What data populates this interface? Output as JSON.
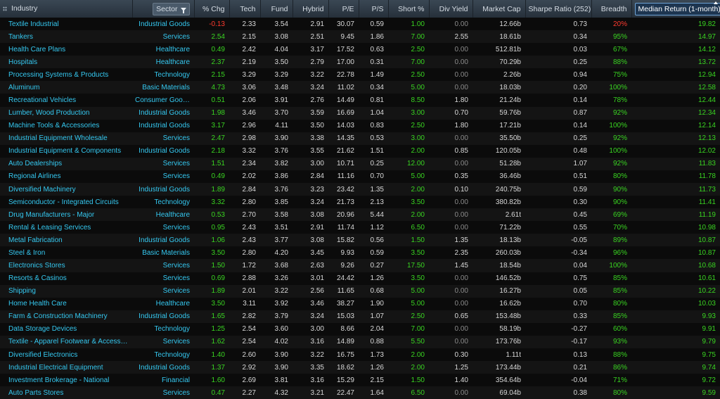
{
  "columns": [
    {
      "key": "industry",
      "label": "Industry"
    },
    {
      "key": "sector",
      "label": "Sector"
    },
    {
      "key": "chg",
      "label": "% Chg"
    },
    {
      "key": "tech",
      "label": "Tech"
    },
    {
      "key": "fund",
      "label": "Fund"
    },
    {
      "key": "hybrid",
      "label": "Hybrid"
    },
    {
      "key": "pe",
      "label": "P/E"
    },
    {
      "key": "ps",
      "label": "P/S"
    },
    {
      "key": "short",
      "label": "Short %"
    },
    {
      "key": "div",
      "label": "Div Yield"
    },
    {
      "key": "mcap",
      "label": "Market Cap"
    },
    {
      "key": "sharpe",
      "label": "Sharpe Ratio (252)"
    },
    {
      "key": "breadth",
      "label": "Breadth"
    },
    {
      "key": "median",
      "label": "Median Return (1-month)"
    }
  ],
  "colors": {
    "link": "#35c8f0",
    "positive": "#39d421",
    "negative": "#ff3b2f",
    "header_bg": "#2f3b47"
  },
  "rows": [
    {
      "industry": "Textile Industrial",
      "sector": "Industrial Goods",
      "chg": "-0.13",
      "tech": "2.33",
      "fund": "3.54",
      "hybrid": "2.91",
      "pe": "30.07",
      "ps": "0.59",
      "short": "1.00",
      "div": "0.00",
      "mcap": "12.66b",
      "sharpe": "0.73",
      "breadth": "20%",
      "median": "19.82"
    },
    {
      "industry": "Tankers",
      "sector": "Services",
      "chg": "2.54",
      "tech": "2.15",
      "fund": "3.08",
      "hybrid": "2.51",
      "pe": "9.45",
      "ps": "1.86",
      "short": "7.00",
      "div": "2.55",
      "mcap": "18.61b",
      "sharpe": "0.34",
      "breadth": "95%",
      "median": "14.97"
    },
    {
      "industry": "Health Care Plans",
      "sector": "Healthcare",
      "chg": "0.49",
      "tech": "2.42",
      "fund": "4.04",
      "hybrid": "3.17",
      "pe": "17.52",
      "ps": "0.63",
      "short": "2.50",
      "div": "0.00",
      "mcap": "512.81b",
      "sharpe": "0.03",
      "breadth": "67%",
      "median": "14.12"
    },
    {
      "industry": "Hospitals",
      "sector": "Healthcare",
      "chg": "2.37",
      "tech": "2.19",
      "fund": "3.50",
      "hybrid": "2.79",
      "pe": "17.00",
      "ps": "0.31",
      "short": "7.00",
      "div": "0.00",
      "mcap": "70.29b",
      "sharpe": "0.25",
      "breadth": "88%",
      "median": "13.72"
    },
    {
      "industry": "Processing Systems & Products",
      "sector": "Technology",
      "chg": "2.15",
      "tech": "3.29",
      "fund": "3.29",
      "hybrid": "3.22",
      "pe": "22.78",
      "ps": "1.49",
      "short": "2.50",
      "div": "0.00",
      "mcap": "2.26b",
      "sharpe": "0.94",
      "breadth": "75%",
      "median": "12.94"
    },
    {
      "industry": "Aluminum",
      "sector": "Basic Materials",
      "chg": "4.73",
      "tech": "3.06",
      "fund": "3.48",
      "hybrid": "3.24",
      "pe": "11.02",
      "ps": "0.34",
      "short": "5.00",
      "div": "0.00",
      "mcap": "18.03b",
      "sharpe": "0.20",
      "breadth": "100%",
      "median": "12.58"
    },
    {
      "industry": "Recreational Vehicles",
      "sector": "Consumer Goods",
      "chg": "0.51",
      "tech": "2.06",
      "fund": "3.91",
      "hybrid": "2.76",
      "pe": "14.49",
      "ps": "0.81",
      "short": "8.50",
      "div": "1.80",
      "mcap": "21.24b",
      "sharpe": "0.14",
      "breadth": "78%",
      "median": "12.44"
    },
    {
      "industry": "Lumber, Wood Production",
      "sector": "Industrial Goods",
      "chg": "1.98",
      "tech": "3.46",
      "fund": "3.70",
      "hybrid": "3.59",
      "pe": "16.69",
      "ps": "1.04",
      "short": "3.00",
      "div": "0.70",
      "mcap": "59.76b",
      "sharpe": "0.87",
      "breadth": "92%",
      "median": "12.34"
    },
    {
      "industry": "Machine Tools & Accessories",
      "sector": "Industrial Goods",
      "chg": "3.17",
      "tech": "2.96",
      "fund": "4.11",
      "hybrid": "3.50",
      "pe": "14.03",
      "ps": "0.83",
      "short": "2.50",
      "div": "1.80",
      "mcap": "17.21b",
      "sharpe": "0.14",
      "breadth": "100%",
      "median": "12.14"
    },
    {
      "industry": "Industrial Equipment Wholesale",
      "sector": "Services",
      "chg": "2.47",
      "tech": "2.98",
      "fund": "3.90",
      "hybrid": "3.38",
      "pe": "14.35",
      "ps": "0.53",
      "short": "3.00",
      "div": "0.00",
      "mcap": "35.50b",
      "sharpe": "0.25",
      "breadth": "92%",
      "median": "12.13"
    },
    {
      "industry": "Industrial Equipment & Components",
      "sector": "Industrial Goods",
      "chg": "2.18",
      "tech": "3.32",
      "fund": "3.76",
      "hybrid": "3.55",
      "pe": "21.62",
      "ps": "1.51",
      "short": "2.00",
      "div": "0.85",
      "mcap": "120.05b",
      "sharpe": "0.48",
      "breadth": "100%",
      "median": "12.02"
    },
    {
      "industry": "Auto Dealerships",
      "sector": "Services",
      "chg": "1.51",
      "tech": "2.34",
      "fund": "3.82",
      "hybrid": "3.00",
      "pe": "10.71",
      "ps": "0.25",
      "short": "12.00",
      "div": "0.00",
      "mcap": "51.28b",
      "sharpe": "1.07",
      "breadth": "92%",
      "median": "11.83"
    },
    {
      "industry": "Regional Airlines",
      "sector": "Services",
      "chg": "0.49",
      "tech": "2.02",
      "fund": "3.86",
      "hybrid": "2.84",
      "pe": "11.16",
      "ps": "0.70",
      "short": "5.00",
      "div": "0.35",
      "mcap": "36.46b",
      "sharpe": "0.51",
      "breadth": "80%",
      "median": "11.78"
    },
    {
      "industry": "Diversified Machinery",
      "sector": "Industrial Goods",
      "chg": "1.89",
      "tech": "2.84",
      "fund": "3.76",
      "hybrid": "3.23",
      "pe": "23.42",
      "ps": "1.35",
      "short": "2.00",
      "div": "0.10",
      "mcap": "240.75b",
      "sharpe": "0.59",
      "breadth": "90%",
      "median": "11.73"
    },
    {
      "industry": "Semiconductor - Integrated Circuits",
      "sector": "Technology",
      "chg": "3.32",
      "tech": "2.80",
      "fund": "3.85",
      "hybrid": "3.24",
      "pe": "21.73",
      "ps": "2.13",
      "short": "3.50",
      "div": "0.00",
      "mcap": "380.82b",
      "sharpe": "0.30",
      "breadth": "90%",
      "median": "11.41"
    },
    {
      "industry": "Drug Manufacturers - Major",
      "sector": "Healthcare",
      "chg": "0.53",
      "tech": "2.70",
      "fund": "3.58",
      "hybrid": "3.08",
      "pe": "20.96",
      "ps": "5.44",
      "short": "2.00",
      "div": "0.00",
      "mcap": "2.61t",
      "sharpe": "0.45",
      "breadth": "69%",
      "median": "11.19"
    },
    {
      "industry": "Rental & Leasing Services",
      "sector": "Services",
      "chg": "0.95",
      "tech": "2.43",
      "fund": "3.51",
      "hybrid": "2.91",
      "pe": "11.74",
      "ps": "1.12",
      "short": "6.50",
      "div": "0.00",
      "mcap": "71.22b",
      "sharpe": "0.55",
      "breadth": "70%",
      "median": "10.98"
    },
    {
      "industry": "Metal Fabrication",
      "sector": "Industrial Goods",
      "chg": "1.06",
      "tech": "2.43",
      "fund": "3.77",
      "hybrid": "3.08",
      "pe": "15.82",
      "ps": "0.56",
      "short": "1.50",
      "div": "1.35",
      "mcap": "18.13b",
      "sharpe": "-0.05",
      "breadth": "89%",
      "median": "10.87"
    },
    {
      "industry": "Steel & Iron",
      "sector": "Basic Materials",
      "chg": "3.50",
      "tech": "2.80",
      "fund": "4.20",
      "hybrid": "3.45",
      "pe": "9.93",
      "ps": "0.59",
      "short": "3.50",
      "div": "2.35",
      "mcap": "260.03b",
      "sharpe": "-0.34",
      "breadth": "96%",
      "median": "10.87"
    },
    {
      "industry": "Electronics Stores",
      "sector": "Services",
      "chg": "1.50",
      "tech": "1.72",
      "fund": "3.68",
      "hybrid": "2.63",
      "pe": "9.26",
      "ps": "0.27",
      "short": "17.50",
      "div": "1.45",
      "mcap": "18.54b",
      "sharpe": "0.04",
      "breadth": "100%",
      "median": "10.68"
    },
    {
      "industry": "Resorts & Casinos",
      "sector": "Services",
      "chg": "0.69",
      "tech": "2.88",
      "fund": "3.26",
      "hybrid": "3.01",
      "pe": "24.42",
      "ps": "1.26",
      "short": "3.50",
      "div": "0.00",
      "mcap": "146.52b",
      "sharpe": "0.75",
      "breadth": "85%",
      "median": "10.61"
    },
    {
      "industry": "Shipping",
      "sector": "Services",
      "chg": "1.89",
      "tech": "2.01",
      "fund": "3.22",
      "hybrid": "2.56",
      "pe": "11.65",
      "ps": "0.68",
      "short": "5.00",
      "div": "0.00",
      "mcap": "16.27b",
      "sharpe": "0.05",
      "breadth": "85%",
      "median": "10.22"
    },
    {
      "industry": "Home Health Care",
      "sector": "Healthcare",
      "chg": "3.50",
      "tech": "3.11",
      "fund": "3.92",
      "hybrid": "3.46",
      "pe": "38.27",
      "ps": "1.90",
      "short": "5.00",
      "div": "0.00",
      "mcap": "16.62b",
      "sharpe": "0.70",
      "breadth": "80%",
      "median": "10.03"
    },
    {
      "industry": "Farm & Construction Machinery",
      "sector": "Industrial Goods",
      "chg": "1.65",
      "tech": "2.82",
      "fund": "3.79",
      "hybrid": "3.24",
      "pe": "15.03",
      "ps": "1.07",
      "short": "2.50",
      "div": "0.65",
      "mcap": "153.48b",
      "sharpe": "0.33",
      "breadth": "85%",
      "median": "9.93"
    },
    {
      "industry": "Data Storage Devices",
      "sector": "Technology",
      "chg": "1.25",
      "tech": "2.54",
      "fund": "3.60",
      "hybrid": "3.00",
      "pe": "8.66",
      "ps": "2.04",
      "short": "7.00",
      "div": "0.00",
      "mcap": "58.19b",
      "sharpe": "-0.27",
      "breadth": "60%",
      "median": "9.91"
    },
    {
      "industry": "Textile - Apparel Footwear & Accessories",
      "sector": "Services",
      "chg": "1.62",
      "tech": "2.54",
      "fund": "4.02",
      "hybrid": "3.16",
      "pe": "14.89",
      "ps": "0.88",
      "short": "5.50",
      "div": "0.00",
      "mcap": "173.76b",
      "sharpe": "-0.17",
      "breadth": "93%",
      "median": "9.79"
    },
    {
      "industry": "Diversified Electronics",
      "sector": "Technology",
      "chg": "1.40",
      "tech": "2.60",
      "fund": "3.90",
      "hybrid": "3.22",
      "pe": "16.75",
      "ps": "1.73",
      "short": "2.00",
      "div": "0.30",
      "mcap": "1.11t",
      "sharpe": "0.13",
      "breadth": "88%",
      "median": "9.75"
    },
    {
      "industry": "Industrial Electrical Equipment",
      "sector": "Industrial Goods",
      "chg": "1.37",
      "tech": "2.92",
      "fund": "3.90",
      "hybrid": "3.35",
      "pe": "18.62",
      "ps": "1.26",
      "short": "2.00",
      "div": "1.25",
      "mcap": "173.44b",
      "sharpe": "0.21",
      "breadth": "86%",
      "median": "9.74"
    },
    {
      "industry": "Investment Brokerage - National",
      "sector": "Financial",
      "chg": "1.60",
      "tech": "2.69",
      "fund": "3.81",
      "hybrid": "3.16",
      "pe": "15.29",
      "ps": "2.15",
      "short": "1.50",
      "div": "1.40",
      "mcap": "354.64b",
      "sharpe": "-0.04",
      "breadth": "71%",
      "median": "9.72"
    },
    {
      "industry": "Auto Parts Stores",
      "sector": "Services",
      "chg": "0.47",
      "tech": "2.27",
      "fund": "4.32",
      "hybrid": "3.21",
      "pe": "22.47",
      "ps": "1.64",
      "short": "6.50",
      "div": "0.00",
      "mcap": "69.04b",
      "sharpe": "0.38",
      "breadth": "80%",
      "median": "9.59"
    }
  ]
}
